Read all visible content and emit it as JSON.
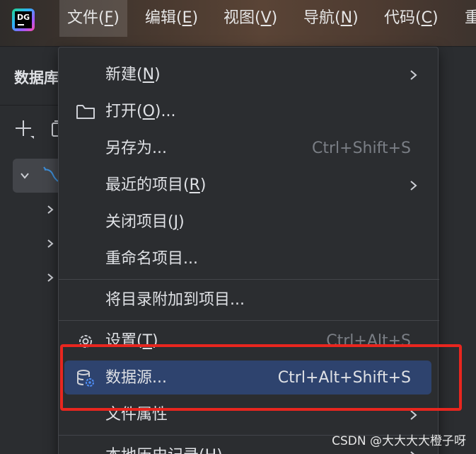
{
  "app": {
    "logo_text": "DG"
  },
  "menubar": {
    "items": [
      {
        "label": "文件(",
        "mnemonic": "F",
        "suffix": ")"
      },
      {
        "label": "编辑(",
        "mnemonic": "E",
        "suffix": ")"
      },
      {
        "label": "视图(",
        "mnemonic": "V",
        "suffix": ")"
      },
      {
        "label": "导航(",
        "mnemonic": "N",
        "suffix": ")"
      },
      {
        "label": "代码(",
        "mnemonic": "C",
        "suffix": ")"
      },
      {
        "label": "重",
        "mnemonic": "",
        "suffix": ""
      }
    ]
  },
  "panel": {
    "title": "数据库"
  },
  "file_menu": {
    "items": [
      {
        "label": "新建(",
        "mnemonic": "N",
        "suffix": ")",
        "shortcut": "",
        "submenu": true,
        "icon": ""
      },
      {
        "label": "打开(",
        "mnemonic": "O",
        "suffix": ")...",
        "shortcut": "",
        "submenu": false,
        "icon": "folder-icon"
      },
      {
        "label": "另存为...",
        "mnemonic": "",
        "suffix": "",
        "shortcut": "Ctrl+Shift+S",
        "submenu": false,
        "icon": ""
      },
      {
        "label": "最近的项目(",
        "mnemonic": "R",
        "suffix": ")",
        "shortcut": "",
        "submenu": true,
        "icon": ""
      },
      {
        "label": "关闭项目(",
        "mnemonic": "J",
        "suffix": ")",
        "shortcut": "",
        "submenu": false,
        "icon": ""
      },
      {
        "label": "重命名项目...",
        "mnemonic": "",
        "suffix": "",
        "shortcut": "",
        "submenu": false,
        "icon": ""
      },
      {
        "label": "将目录附加到项目...",
        "mnemonic": "",
        "suffix": "",
        "shortcut": "",
        "submenu": false,
        "icon": ""
      },
      {
        "label": "设置(",
        "mnemonic": "T",
        "suffix": ")",
        "shortcut": "Ctrl+Alt+S",
        "submenu": false,
        "icon": "gear-icon"
      },
      {
        "label": "数据源...",
        "mnemonic": "",
        "suffix": "",
        "shortcut": "Ctrl+Alt+Shift+S",
        "submenu": false,
        "icon": "datasource-icon",
        "highlighted": true
      },
      {
        "label": "文件属性",
        "mnemonic": "",
        "suffix": "",
        "shortcut": "",
        "submenu": true,
        "icon": ""
      },
      {
        "label": "本地历史记录(",
        "mnemonic": "H",
        "suffix": ")",
        "shortcut": "",
        "submenu": true,
        "icon": ""
      }
    ]
  },
  "colors": {
    "highlight": "#2e436e",
    "annotation_box": "#e8261f",
    "background": "#2b2d30"
  },
  "watermark": "CSDN @大大大大橙子呀"
}
